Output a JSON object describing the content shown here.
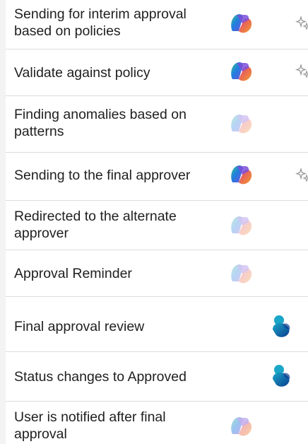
{
  "rows": [
    {
      "label": "Sending for interim approval based on policies",
      "icon": "copilot-icon",
      "faded": false,
      "sparkle": true
    },
    {
      "label": "Validate against policy",
      "icon": "copilot-icon",
      "faded": false,
      "sparkle": true
    },
    {
      "label": "Finding anomalies based on patterns",
      "icon": "copilot-icon",
      "faded": true,
      "sparkle": false
    },
    {
      "label": "Sending to the final approver",
      "icon": "copilot-icon",
      "faded": false,
      "sparkle": true
    },
    {
      "label": "Redirected to the alternate approver",
      "icon": "copilot-icon",
      "faded": true,
      "sparkle": false
    },
    {
      "label": "Approval Reminder",
      "icon": "copilot-icon",
      "faded": true,
      "sparkle": false
    },
    {
      "label": "Final approval review",
      "icon": "dynamics-icon",
      "faded": false,
      "sparkle": false
    },
    {
      "label": "Status changes to Approved",
      "icon": "dynamics-icon",
      "faded": false,
      "sparkle": false
    },
    {
      "label": "User is notified after final approval",
      "icon": "copilot-icon",
      "faded": true,
      "sparkle": false
    }
  ],
  "colors": {
    "copilot_blue": "#1f7fe0",
    "copilot_purple": "#7b4fd9",
    "copilot_pink": "#e0407a",
    "copilot_orange": "#f39a2b",
    "copilot_green": "#3cc28a",
    "dynamics_teal": "#1aa6c8",
    "dynamics_navy": "#0b3d8f"
  }
}
